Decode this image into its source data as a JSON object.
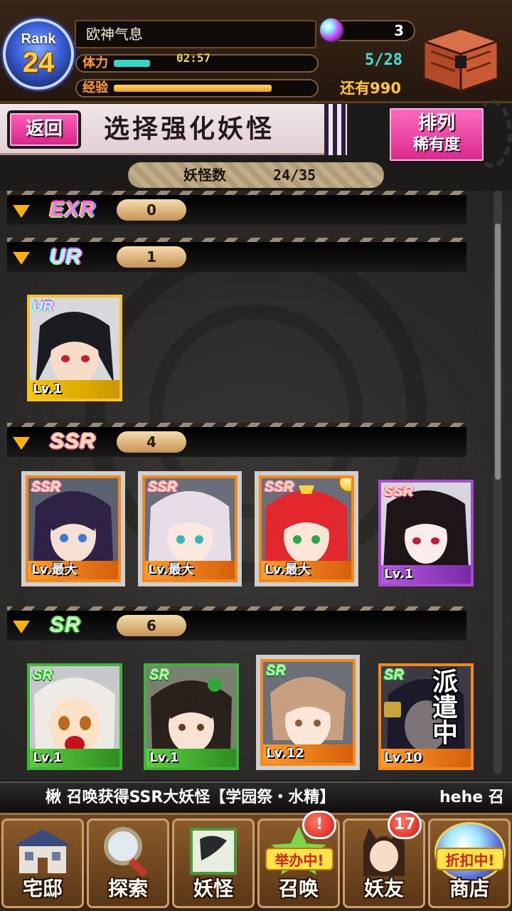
{
  "hud": {
    "rank_label": "Rank",
    "rank_value": "24",
    "player_name": "欧神气息",
    "stamina_label": "体力",
    "stamina_timer": "02:57",
    "stamina_count": "5/28",
    "stamina_fill": 0.18,
    "exp_label": "经验",
    "exp_fill": 0.78,
    "exp_remaining": "还有990",
    "gems": "3"
  },
  "header": {
    "back_label": "返回",
    "title": "选择强化妖怪",
    "sort_line1": "排列",
    "sort_line2": "稀有度"
  },
  "count": {
    "label": "妖怪数",
    "value": "24/35"
  },
  "sections": [
    {
      "rarity": "EXR",
      "count": "0"
    },
    {
      "rarity": "UR",
      "count": "1"
    },
    {
      "rarity": "SSR",
      "count": "4"
    },
    {
      "rarity": "SR",
      "count": "6"
    }
  ],
  "cards": {
    "ur": [
      {
        "tag": "UR",
        "level": "Lv.1"
      }
    ],
    "ssr": [
      {
        "tag": "SSR",
        "level": "Lv.最大"
      },
      {
        "tag": "SSR",
        "level": "Lv.最大"
      },
      {
        "tag": "SSR",
        "level": "Lv.最大"
      },
      {
        "tag": "SSR",
        "level": "Lv.1"
      }
    ],
    "sr": [
      {
        "tag": "SR",
        "level": "Lv.1"
      },
      {
        "tag": "SR",
        "level": "Lv.1"
      },
      {
        "tag": "SR",
        "level": "Lv.12"
      },
      {
        "tag": "SR",
        "level": "Lv.10",
        "status": "派遣中"
      }
    ]
  },
  "ticker": {
    "message": "楸 召唤获得SSR大妖怪【学园祭・水精】",
    "message2": "hehe 召"
  },
  "nav": [
    {
      "label": "宅邸",
      "icon": "mansion-icon"
    },
    {
      "label": "探索",
      "icon": "magnifier-icon"
    },
    {
      "label": "妖怪",
      "icon": "scroll-icon"
    },
    {
      "label": "召唤",
      "icon": "summon-icon",
      "ribbon": "举办中!",
      "badge": "!"
    },
    {
      "label": "妖友",
      "icon": "friend-icon",
      "badge": "17"
    },
    {
      "label": "商店",
      "icon": "shop-orb-icon",
      "ribbon": "折扣中!"
    }
  ],
  "colors": {
    "accent_pink": "#d6248a",
    "stamina": "#35d6c4",
    "exp": "#f0a021",
    "rank_gold": "#ffd23a"
  }
}
